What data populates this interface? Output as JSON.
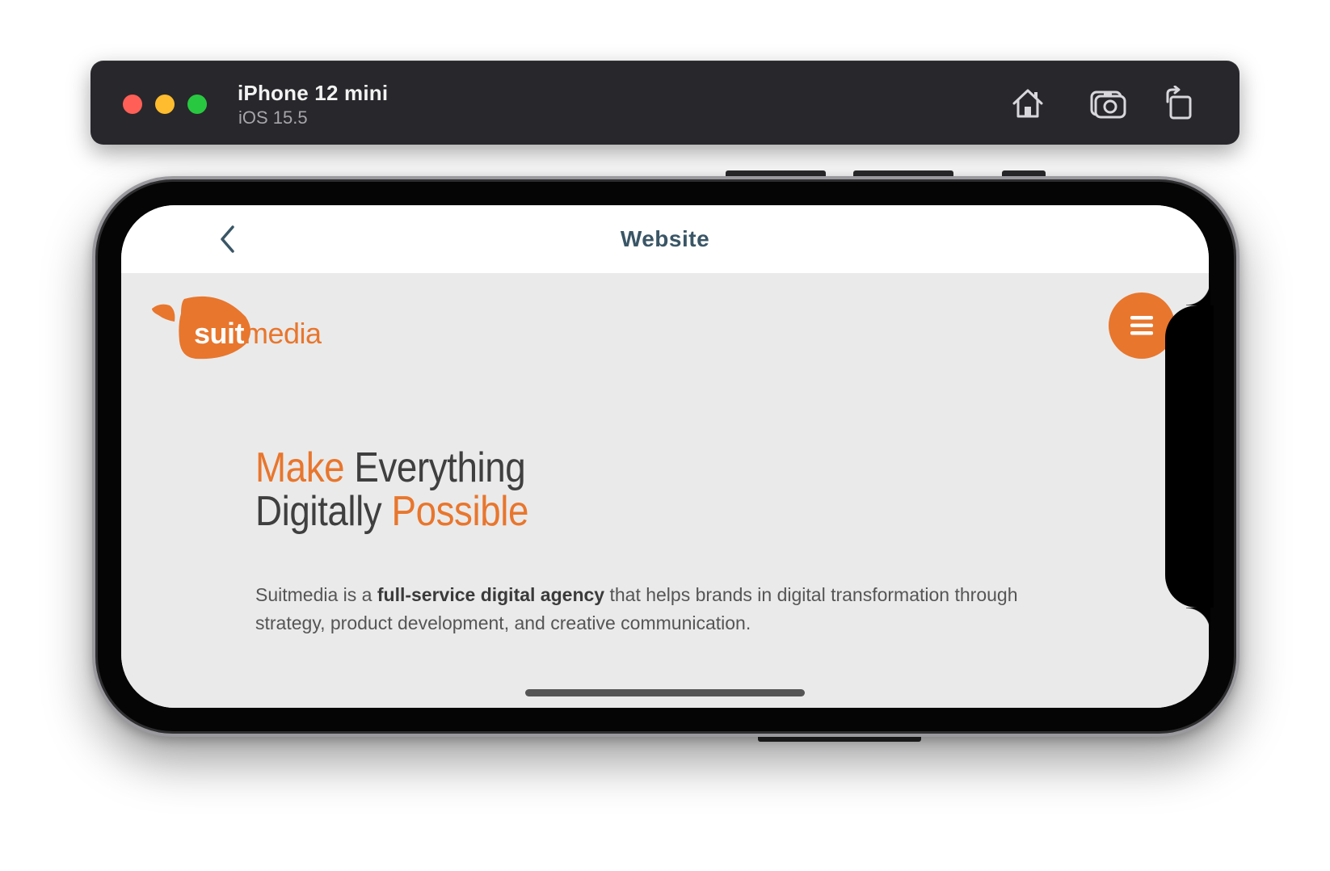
{
  "simulator": {
    "device_name": "iPhone 12 mini",
    "os_version": "iOS 15.5",
    "tools": {
      "home_icon": "home-icon",
      "screenshot_icon": "camera-icon",
      "rotate_icon": "rotate-icon"
    }
  },
  "nav": {
    "back_icon": "chevron-left-icon",
    "title": "Website"
  },
  "site": {
    "logo": {
      "part1": "suit",
      "part2": "media"
    },
    "menu_icon": "hamburger-icon",
    "headline": {
      "line1_accent": "Make",
      "line1_rest": " Everything",
      "line2_rest": "Digitally ",
      "line2_accent": "Possible"
    },
    "description": {
      "before": "Suitmedia is a ",
      "bold": "full-service digital agency",
      "after": " that helps brands in digital transformation through strategy, product development, and creative communication."
    }
  },
  "colors": {
    "brand_orange": "#e8762d",
    "nav_title": "#3a5666",
    "page_bg": "#eaeaea",
    "sim_bar": "#28272b"
  }
}
